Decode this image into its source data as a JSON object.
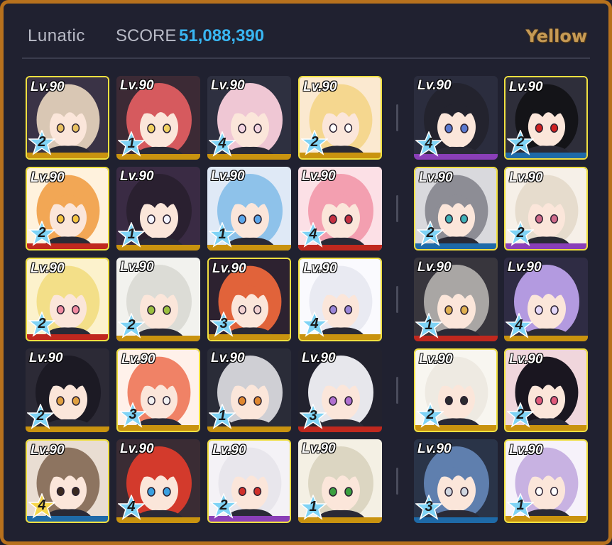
{
  "header": {
    "difficulty": "Lunatic",
    "score_label": "SCORE",
    "score_value": "51,088,390",
    "armor_type": "Yellow"
  },
  "colors": {
    "frame": "#b7711d",
    "background": "#202130",
    "score": "#39b6f2",
    "selected_border": "#f0e040",
    "star_blue": "#7fd3f5",
    "star_gold": "#f6d64a",
    "role_gold": "#c9930f",
    "role_red": "#c0281e",
    "role_blue": "#1e6aa8",
    "role_purple": "#8a3fb8"
  },
  "students": [
    {
      "level": "Lv.90",
      "stars": "2",
      "star_color": "blue",
      "bar": "gold",
      "selected": true,
      "hair": "#d9c7b4",
      "bg": "#3a3346",
      "accent": "#e8c060"
    },
    {
      "level": "Lv.90",
      "stars": "1",
      "star_color": "blue",
      "bar": "gold",
      "selected": false,
      "hair": "#d65a5e",
      "bg": "#3c2a35",
      "accent": "#f0d060"
    },
    {
      "level": "Lv.90",
      "stars": "4",
      "star_color": "blue",
      "bar": "gold",
      "selected": false,
      "hair": "#efc7d4",
      "bg": "#2e3040",
      "accent": "#f2d4e0"
    },
    {
      "level": "Lv.90",
      "stars": "2",
      "star_color": "blue",
      "bar": "gold",
      "selected": true,
      "hair": "#f5d78f",
      "bg": "#fbe9d0",
      "accent": "#ffffff"
    },
    {
      "level": "Lv.90",
      "stars": "4",
      "star_color": "blue",
      "bar": "purple",
      "selected": false,
      "hair": "#23232e",
      "bg": "#2b2d3e",
      "accent": "#5a7ad0"
    },
    {
      "level": "Lv.90",
      "stars": "2",
      "star_color": "blue",
      "bar": "blue",
      "selected": true,
      "hair": "#141418",
      "bg": "#2e2e3a",
      "accent": "#d02020"
    },
    {
      "level": "Lv.90",
      "stars": "2",
      "star_color": "blue",
      "bar": "red",
      "selected": true,
      "hair": "#f2a755",
      "bg": "#fff2dd",
      "accent": "#f5c542"
    },
    {
      "level": "Lv.90",
      "stars": "1",
      "star_color": "blue",
      "bar": "gold",
      "selected": false,
      "hair": "#2a2030",
      "bg": "#3a2b44",
      "accent": "#f4f4ff"
    },
    {
      "level": "Lv.90",
      "stars": "1",
      "star_color": "blue",
      "bar": "gold",
      "selected": false,
      "hair": "#8ec2ea",
      "bg": "#dfe9f6",
      "accent": "#5ba6ea"
    },
    {
      "level": "Lv.90",
      "stars": "4",
      "star_color": "blue",
      "bar": "red",
      "selected": false,
      "hair": "#f39fb0",
      "bg": "#fce0e6",
      "accent": "#c43040"
    },
    {
      "level": "Lv.90",
      "stars": "2",
      "star_color": "blue",
      "bar": "blue",
      "selected": true,
      "hair": "#8d8d95",
      "bg": "#d9d9dd",
      "accent": "#3fb2b8"
    },
    {
      "level": "Lv.90",
      "stars": "2",
      "star_color": "blue",
      "bar": "purple",
      "selected": true,
      "hair": "#e6dccd",
      "bg": "#f6f0e8",
      "accent": "#d06a8a"
    },
    {
      "level": "Lv.90",
      "stars": "2",
      "star_color": "blue",
      "bar": "red",
      "selected": true,
      "hair": "#f3df88",
      "bg": "#fcf2cc",
      "accent": "#f08aa0"
    },
    {
      "level": "Lv.90",
      "stars": "2",
      "star_color": "blue",
      "bar": "gold",
      "selected": false,
      "hair": "#dcdcd6",
      "bg": "#f2f2ee",
      "accent": "#9bc040"
    },
    {
      "level": "Lv.90",
      "stars": "3",
      "star_color": "blue",
      "bar": "gold",
      "selected": true,
      "hair": "#e1633a",
      "bg": "#2d2230",
      "accent": "#f0d0d0"
    },
    {
      "level": "Lv.90",
      "stars": "4",
      "star_color": "blue",
      "bar": "gold",
      "selected": true,
      "hair": "#e9eaf2",
      "bg": "#fafafe",
      "accent": "#9a86d8"
    },
    {
      "level": "Lv.90",
      "stars": "1",
      "star_color": "blue",
      "bar": "red",
      "selected": false,
      "hair": "#a9a6a4",
      "bg": "#38363d",
      "accent": "#e0b050"
    },
    {
      "level": "Lv.90",
      "stars": "4",
      "star_color": "blue",
      "bar": "gold",
      "selected": false,
      "hair": "#b39ae0",
      "bg": "#2f2c44",
      "accent": "#e4d8fa"
    },
    {
      "level": "Lv.90",
      "stars": "2",
      "star_color": "blue",
      "bar": "gold",
      "selected": false,
      "hair": "#1c1a24",
      "bg": "#2c2a36",
      "accent": "#e0a040"
    },
    {
      "level": "Lv.90",
      "stars": "3",
      "star_color": "blue",
      "bar": "gold",
      "selected": true,
      "hair": "#f08266",
      "bg": "#fff1ea",
      "accent": "#f0f0f0"
    },
    {
      "level": "Lv.90",
      "stars": "1",
      "star_color": "blue",
      "bar": "gold",
      "selected": false,
      "hair": "#cfcfd4",
      "bg": "#2a2c38",
      "accent": "#e08830"
    },
    {
      "level": "Lv.90",
      "stars": "3",
      "star_color": "blue",
      "bar": "red",
      "selected": false,
      "hair": "#e7e7ec",
      "bg": "#22222e",
      "accent": "#b070d0"
    },
    {
      "level": "Lv.90",
      "stars": "2",
      "star_color": "blue",
      "bar": "gold",
      "selected": true,
      "hair": "#eeeae2",
      "bg": "#f8f6f0",
      "accent": "#2a2a30"
    },
    {
      "level": "Lv.90",
      "stars": "2",
      "star_color": "blue",
      "bar": "gold",
      "selected": true,
      "hair": "#1a1620",
      "bg": "#f0d6dc",
      "accent": "#e05a7a"
    },
    {
      "level": "Lv.90",
      "stars": "4",
      "star_color": "gold",
      "bar": "blue",
      "selected": true,
      "hair": "#8d7460",
      "bg": "#e9ddd2",
      "accent": "#3a2a20"
    },
    {
      "level": "Lv.90",
      "stars": "4",
      "star_color": "blue",
      "bar": "gold",
      "selected": false,
      "hair": "#d33a2c",
      "bg": "#3a2c34",
      "accent": "#3aa0e0"
    },
    {
      "level": "Lv.90",
      "stars": "2",
      "star_color": "blue",
      "bar": "purple",
      "selected": true,
      "hair": "#e8e6ec",
      "bg": "#f4f2f6",
      "accent": "#d0302a"
    },
    {
      "level": "Lv.90",
      "stars": "1",
      "star_color": "blue",
      "bar": "gold",
      "selected": false,
      "hair": "#dcd6c2",
      "bg": "#f4f0e4",
      "accent": "#3aa040"
    },
    {
      "level": "Lv.90",
      "stars": "3",
      "star_color": "blue",
      "bar": "blue",
      "selected": false,
      "hair": "#5f7fae",
      "bg": "#2a3448",
      "accent": "#d0d6e0"
    },
    {
      "level": "Lv.90",
      "stars": "1",
      "star_color": "blue",
      "bar": "gold",
      "selected": true,
      "hair": "#c8b2e2",
      "bg": "#f6f2fa",
      "accent": "#ffffff"
    }
  ]
}
